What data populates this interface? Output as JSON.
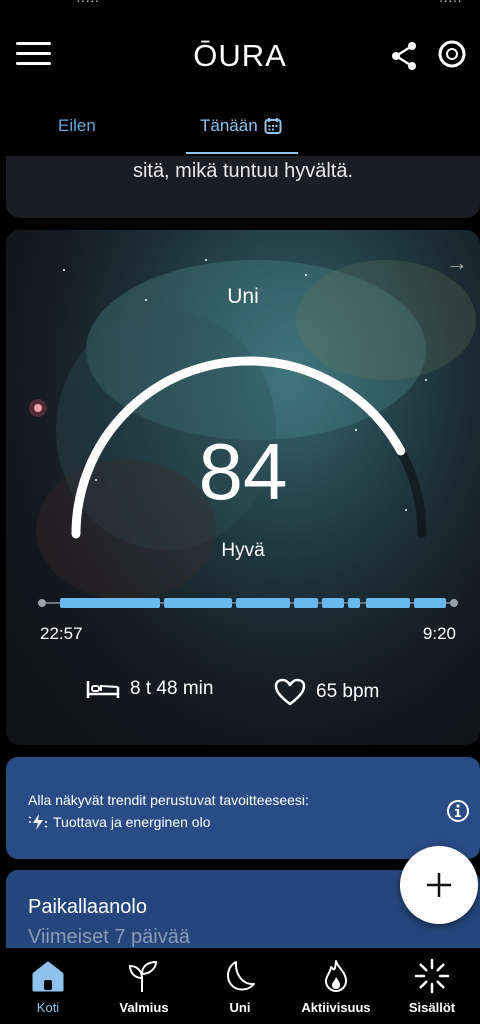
{
  "app": {
    "logo": "ŌURA"
  },
  "tabs": [
    {
      "label": "Eilen"
    },
    {
      "label": "Tänään"
    }
  ],
  "top_card": {
    "text": "sitä, mikä tuntuu hyvältä."
  },
  "sleep": {
    "title": "Uni",
    "score": "84",
    "score_fraction": 0.84,
    "rating": "Hyvä",
    "bedtime": "22:57",
    "wake_time": "9:20",
    "duration": "8 t 48 min",
    "heart_rate": "65 bpm"
  },
  "info": {
    "line1": "Alla näkyvät trendit perustuvat tavoitteeseesi:",
    "line2": "Tuottava ja energinen olo"
  },
  "bottom_card": {
    "title": "Paikallaanolo",
    "subtitle": "Viimeiset 7 päivää"
  },
  "nav": [
    {
      "label": "Koti",
      "icon": "home-icon"
    },
    {
      "label": "Valmius",
      "icon": "sprout-icon"
    },
    {
      "label": "Uni",
      "icon": "moon-icon"
    },
    {
      "label": "Aktiivisuus",
      "icon": "flame-icon"
    },
    {
      "label": "Sisällöt",
      "icon": "burst-icon"
    }
  ],
  "colors": {
    "accent": "#8fc3ee",
    "timeline": "#6ab8f0",
    "info_card": "#2a4c86"
  }
}
